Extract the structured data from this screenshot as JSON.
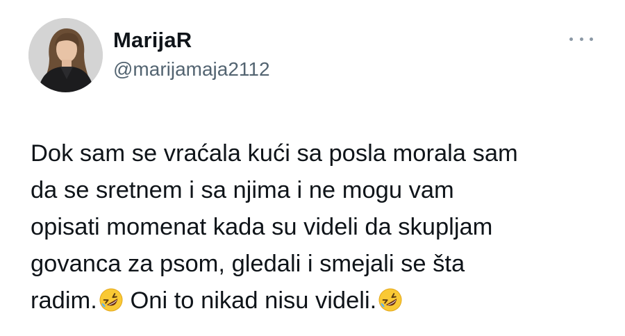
{
  "author": {
    "display_name": "MarijaR",
    "handle": "@marijamaja2112",
    "avatar_icon": "profile-photo"
  },
  "more_menu": {
    "icon": "more-horizontal-icon"
  },
  "tweet": {
    "lines": [
      "Dok sam se vraćala kući sa posla morala sam",
      "da se sretnem i sa njima i ne mogu vam",
      "opisati momenat kada su videli da skupljam",
      "govanca za psom, gledali i smejali se šta"
    ],
    "last_line_part1": "radim.",
    "last_line_part2": " Oni to nikad nisu videli.",
    "emoji": "rolling-on-the-floor-laughing"
  },
  "colors": {
    "text_primary": "#0f1419",
    "text_secondary": "#536471"
  }
}
